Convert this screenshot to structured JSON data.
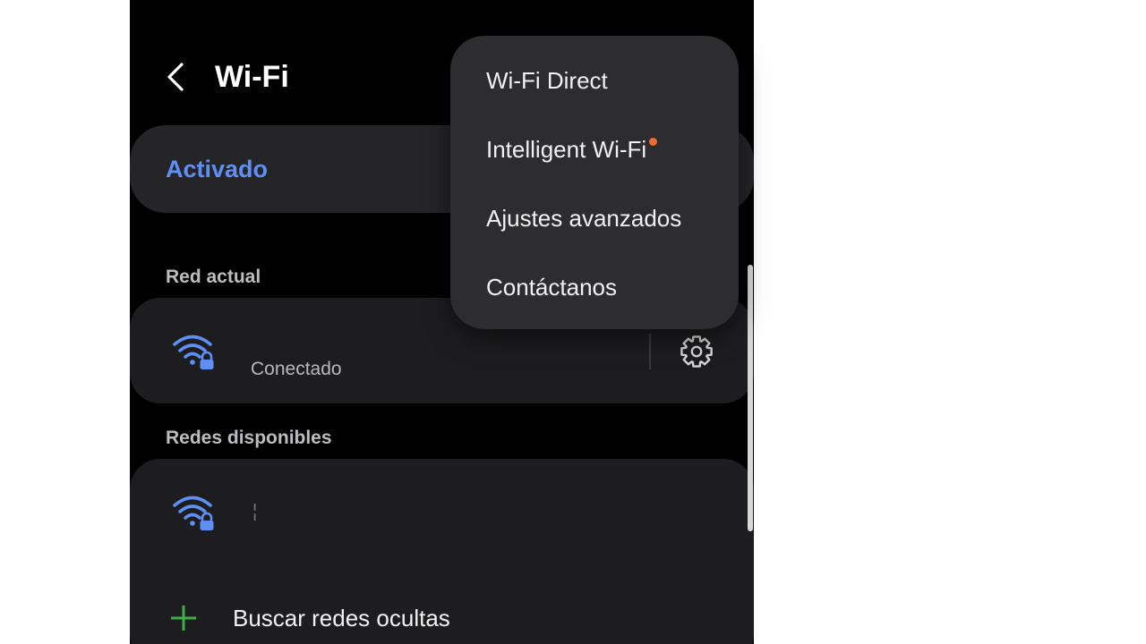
{
  "header": {
    "title": "Wi-Fi",
    "back_icon": "chevron-left-icon"
  },
  "master_toggle": {
    "label": "Activado",
    "accent_color": "#5e8ff4"
  },
  "current_network": {
    "section_label": "Red actual",
    "status": "Conectado",
    "wifi_icon": "wifi-lock-icon",
    "settings_icon": "gear-icon"
  },
  "available_networks": {
    "section_label": "Redes disponibles",
    "items": [
      {
        "name": "",
        "wifi_icon": "wifi-lock-icon",
        "cursor_mark": "¦"
      }
    ]
  },
  "add_hidden": {
    "label": "Buscar redes ocultas",
    "icon": "plus-icon",
    "icon_color": "#3fae49"
  },
  "overflow_menu": {
    "items": [
      {
        "label": "Wi-Fi Direct"
      },
      {
        "label": "Intelligent Wi-Fi",
        "badge_color": "#f26a2c"
      },
      {
        "label": "Ajustes avanzados"
      },
      {
        "label": "Contáctanos"
      }
    ]
  }
}
